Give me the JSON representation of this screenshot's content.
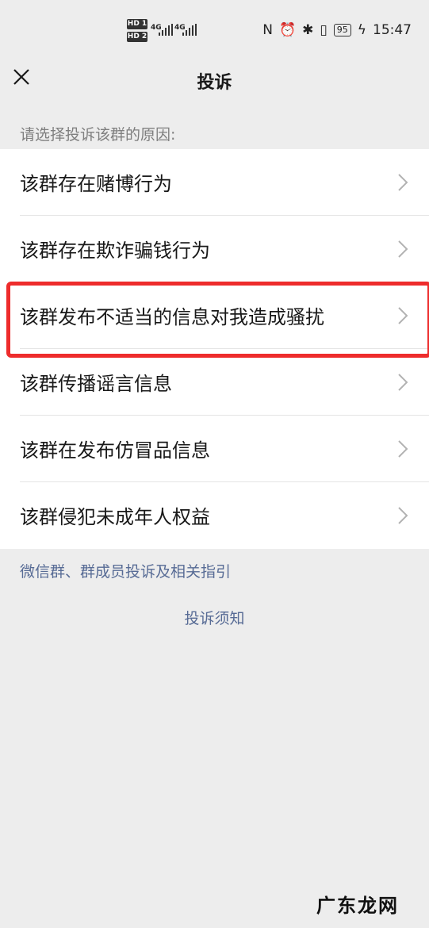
{
  "status_bar": {
    "sim1": "HD 1",
    "sim2": "HD 2",
    "net1": "4G",
    "net2": "4G",
    "battery": "95",
    "time": "15:47"
  },
  "nav": {
    "title": "投诉"
  },
  "section_hint": "请选择投诉该群的原因:",
  "reasons": [
    "该群存在赌博行为",
    "该群存在欺诈骗钱行为",
    "该群发布不适当的信息对我造成骚扰",
    "该群传播谣言信息",
    "该群在发布仿冒品信息",
    "该群侵犯未成年人权益"
  ],
  "guide_link": "微信群、群成员投诉及相关指引",
  "notice_link": "投诉须知",
  "watermark": "广东龙网",
  "colors": {
    "background": "#ededed",
    "link": "#576b95",
    "highlight": "#ee2c2c"
  }
}
